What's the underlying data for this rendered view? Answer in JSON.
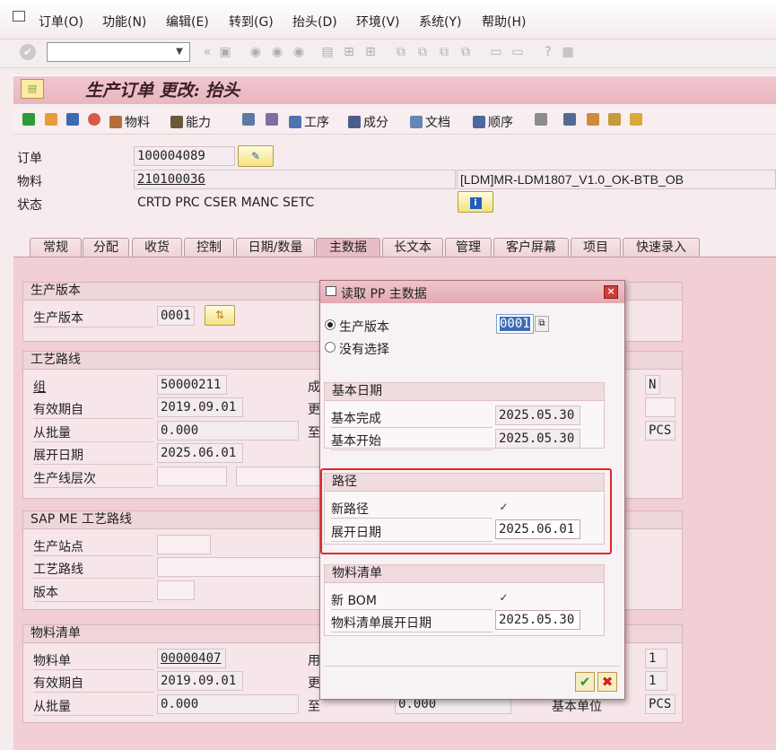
{
  "menubar": {
    "items": [
      "订单(O)",
      "功能(N)",
      "编辑(E)",
      "转到(G)",
      "抬头(D)",
      "环境(V)",
      "系统(Y)",
      "帮助(H)"
    ]
  },
  "page_title": "生产订单 更改: 抬头",
  "toolbar2": {
    "material": "物料",
    "capacity": "能力",
    "operations": "工序",
    "components": "成分",
    "documents": "文档",
    "sequence": "顺序"
  },
  "header": {
    "order_label": "订单",
    "order_value": "100004089",
    "material_label": "物料",
    "material_value": "210100036",
    "material_desc": "[LDM]MR-LDM1807_V1.0_OK-BTB_OB",
    "status_label": "状态",
    "status_value": "CRTD PRC  CSER MANC SETC"
  },
  "tabs": [
    "常规",
    "分配",
    "收货",
    "控制",
    "日期/数量",
    "主数据",
    "长文本",
    "管理",
    "客户屏幕",
    "项目",
    "快速录入"
  ],
  "active_tab": "主数据",
  "prod_version_group": {
    "title": "生产版本",
    "label": "生产版本",
    "value": "0001"
  },
  "routing_group": {
    "title": "工艺路线",
    "group_label": "组",
    "group_value": "50000211",
    "valid_from_label": "有效期自",
    "valid_from_value": "2019.09.01",
    "from_lot_label": "从批量",
    "from_lot_value": "0.000",
    "explosion_date_label": "展开日期",
    "explosion_date_value": "2025.06.01",
    "line_level_label": "生产线层次",
    "partial_1": "成",
    "partial_2": "更",
    "partial_3": "至",
    "right_n": "N",
    "right_pcs": "PCS"
  },
  "sapme_group": {
    "title": "SAP ME 工艺路线",
    "station_label": "生产站点",
    "routing_label": "工艺路线",
    "version_label": "版本"
  },
  "bom_group": {
    "title": "物料清单",
    "bom_label": "物料单",
    "bom_value": "00000407",
    "valid_from_label": "有效期自",
    "valid_from_value": "2019.09.01",
    "from_lot_label": "从批量",
    "from_lot_value": "0.000",
    "partial_1": "用",
    "partial_2": "更",
    "partial_3": "至",
    "to_lot_value": "0.000",
    "base_unit_label": "基本单位",
    "right_1a": "1",
    "right_1b": "1",
    "right_pcs": "PCS"
  },
  "dialog": {
    "title": "读取 PP 主数据",
    "radio_prod_version": "生产版本",
    "prod_version_value": "0001",
    "radio_no_selection": "没有选择",
    "basic_dates": {
      "title": "基本日期",
      "finish_label": "基本完成",
      "finish_value": "2025.05.30",
      "start_label": "基本开始",
      "start_value": "2025.05.30"
    },
    "routing": {
      "title": "路径",
      "new_routing_label": "新路径",
      "new_routing_checked": true,
      "explosion_label": "展开日期",
      "explosion_value": "2025.06.01"
    },
    "bom": {
      "title": "物料清单",
      "new_bom_label": "新 BOM",
      "new_bom_checked": true,
      "explosion_label": "物料清单展开日期",
      "explosion_value": "2025.05.30"
    }
  },
  "colors": {
    "highlight_border": "#e4252b",
    "title_bar": "#e9b5bf",
    "content_bg": "#f1cfd5"
  }
}
